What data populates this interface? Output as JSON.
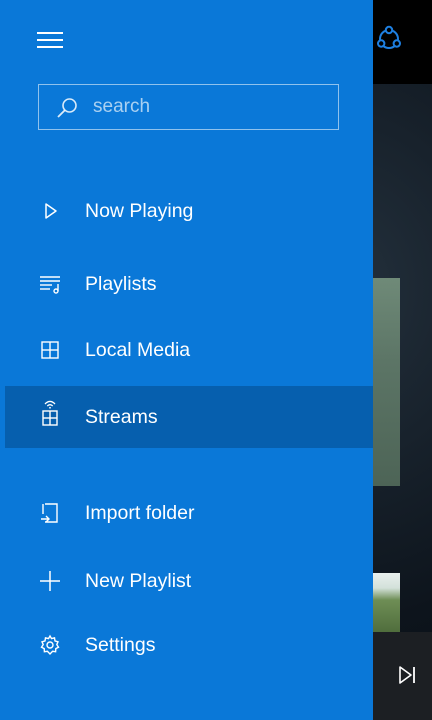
{
  "search": {
    "placeholder": "search"
  },
  "nav": {
    "items": [
      {
        "label": "Now Playing",
        "icon": "play-icon"
      },
      {
        "label": "Playlists",
        "icon": "playlist-icon"
      },
      {
        "label": "Local Media",
        "icon": "local-media-icon"
      },
      {
        "label": "Streams",
        "icon": "streams-icon",
        "selected": true
      }
    ],
    "actions": [
      {
        "label": "Import folder",
        "icon": "import-folder-icon"
      },
      {
        "label": "New Playlist",
        "icon": "plus-icon"
      },
      {
        "label": "Settings",
        "icon": "gear-icon"
      }
    ]
  },
  "colors": {
    "drawer": "#0a78d8",
    "selected": "#065fae",
    "accent": "#1e7fe0"
  }
}
